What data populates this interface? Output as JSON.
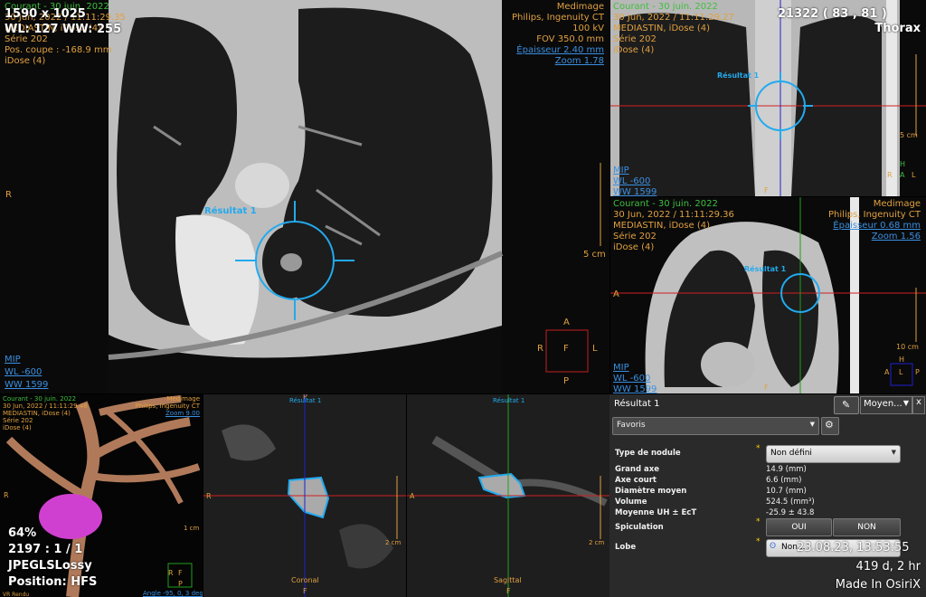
{
  "axial": {
    "left_top": [
      "Courant - 30 juin. 2022",
      "30 Jun, 2022 / 11:11:29.35",
      "MEDIASTIN, iDose (4)",
      "Série 202",
      "Pos. coupe : -168.9 mm",
      "iDose (4)"
    ],
    "resolution": "1590 x 1025",
    "wl_ww": "WL: 127 WW: 255",
    "right_top": [
      "Medimage",
      "Philips, Ingenuity CT",
      "100 kV",
      "FOV 350.0 mm"
    ],
    "epaisseur": "Épaisseur 2.40 mm",
    "zoom": "Zoom 1.78",
    "mip": "MIP",
    "wl": "WL  -600",
    "ww": "WW  1599",
    "left_marker": "R",
    "scale": "5 cm",
    "result_label": "Résultat 1",
    "orient": {
      "top": "A",
      "left": "R",
      "center": "F",
      "right": "L",
      "bottom": "P"
    }
  },
  "coronal_top": {
    "left_top": [
      "Courant - 30 juin. 2022",
      "30 Jun, 2022 / 11:11:29.27",
      "MEDIASTIN, iDose (4)",
      "Série 202",
      "iDose (4)"
    ],
    "counter": "21322 (  83 ,  81 )",
    "right_top": [
      "Thorax"
    ],
    "result_label": "Résultat 1",
    "mip": "MIP",
    "wl": "WL  -600",
    "ww": "WW  1599",
    "scale": "5 cm",
    "orient": {
      "top": "H",
      "left": "R",
      "center": "A",
      "right": "L",
      "bottom": "F"
    }
  },
  "sagittal_top": {
    "left_top": [
      "Courant - 30 juin. 2022",
      "30 Jun, 2022 / 11:11:29.36",
      "MEDIASTIN, iDose (4)",
      "Série 202",
      "iDose (4)"
    ],
    "right_top": [
      "Medimage",
      "Philips, Ingenuity CT"
    ],
    "epaisseur": "Épaisseur 0.68 mm",
    "zoom": "Zoom 1.56",
    "result_label": "Résultat 1",
    "mip": "MIP",
    "wl": "WL  -600",
    "ww": "WW  1599",
    "scale": "10 cm",
    "left_marker": "A",
    "orient": {
      "top": "H",
      "left": "A",
      "center": "L",
      "right": "P",
      "bottom": "F"
    }
  },
  "render3d": {
    "left_top": [
      "Courant - 30 juin. 2022",
      "30 Jun, 2022 / 11:11:29.46",
      "MEDIASTIN, iDose (4)",
      "Série 202",
      "iDose (4)"
    ],
    "right_top": [
      "Medimage",
      "Philips, Ingenuity CT"
    ],
    "zoom": "Zoom 9.00",
    "pct": "64%",
    "frame": "2197 : 1 / 1",
    "codec": "JPEGLSLossy",
    "position": "Position: HFS",
    "left_marker": "R",
    "scale": "1 cm",
    "angle": "Angle -95, 0, 3 deg",
    "vr": "VR Rendu",
    "orient": {
      "top": "R",
      "center": "F",
      "bottom": "P"
    }
  },
  "coronal_small": {
    "result_label": "Résultat 1",
    "label": "Coronal",
    "scale": "2 cm",
    "left_marker": "R",
    "top_marker": "P",
    "bottom_marker": "F"
  },
  "sagittal_small": {
    "result_label": "Résultat 1",
    "label": "Sagittal",
    "scale": "2 cm",
    "left_marker": "A",
    "bottom_marker": "F"
  },
  "panel": {
    "title": "Résultat 1",
    "dropdown": "Moyen...",
    "close": "x",
    "favoris": "Favoris",
    "rows": [
      {
        "label": "Type de nodule",
        "value": "Non défini"
      },
      {
        "label": "Grand axe",
        "value": "14.9 (mm)"
      },
      {
        "label": "Axe court",
        "value": "6.6 (mm)"
      },
      {
        "label": "Diamètre moyen",
        "value": "10.7 (mm)"
      },
      {
        "label": "Volume",
        "value": "524.5 (mm³)"
      },
      {
        "label": "Moyenne UH ± EcT",
        "value": "-25.9 ± 43.8"
      },
      {
        "label": "Spiculation",
        "value": ""
      },
      {
        "label": "Lobe",
        "value": ""
      }
    ],
    "oui": "OUI",
    "non": "NON",
    "lobe_value": "Non...",
    "datetime": "23.08.23, 13:53:55",
    "elapsed": "419 d, 2 hr",
    "made": "Made In OsiriX"
  },
  "colors": {
    "orange": "#e0a040",
    "green": "#3fbf3f",
    "blue": "#3a8fe0",
    "cyan": "#22aaee",
    "magenta": "#d040d0"
  }
}
